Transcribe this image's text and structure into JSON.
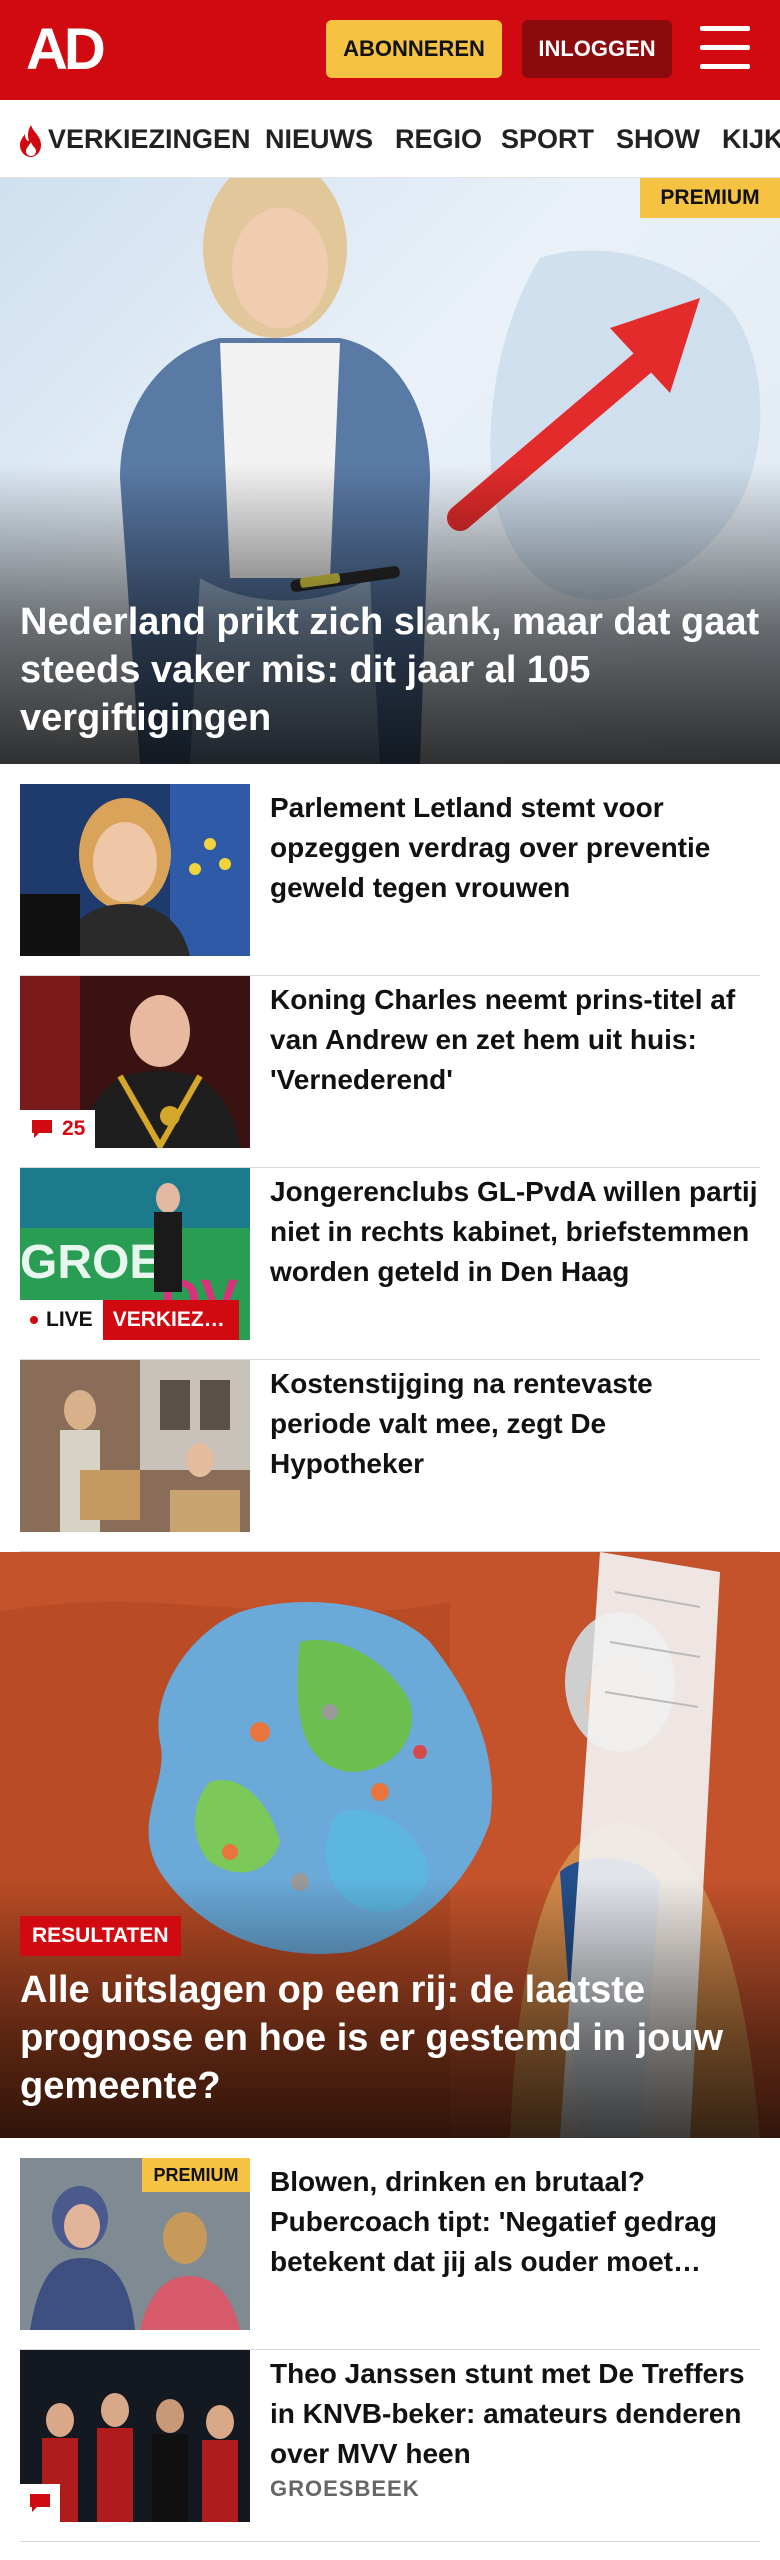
{
  "header": {
    "logo": "AD",
    "subscribe_label": "ABONNEREN",
    "login_label": "INLOGGEN"
  },
  "nav": {
    "items": [
      "VERKIEZINGEN",
      "NIEUWS",
      "REGIO",
      "SPORT",
      "SHOW",
      "KIJK"
    ]
  },
  "hero": {
    "badge": "PREMIUM",
    "title": "Nederland prikt zich slank, maar dat gaat steeds vaker mis: dit jaar al 105 vergiftigingen"
  },
  "articles": [
    {
      "title": "Parlement Letland stemt voor opzeggen verdrag over preventie geweld tegen vrouwen"
    },
    {
      "title": "Koning Charles neemt prins-titel af van Andrew en zet hem uit huis: 'Vernederend'",
      "comments": "25"
    },
    {
      "title": "Jongerenclubs GL-PvdA willen partij niet in rechts kabinet, briefstemmen worden geteld in Den Haag",
      "live": "LIVE",
      "tag": "VERKIEZINGEN"
    },
    {
      "title": "Kostenstijging na rentevaste periode valt mee, zegt De Hypotheker"
    }
  ],
  "feature": {
    "badge": "RESULTATEN",
    "title": "Alle uitslagen op een rij: de laatste prognose en hoe is er gestemd in jouw gemeente?"
  },
  "articles2": [
    {
      "title": "Blowen, drinken en brutaal? Pubercoach tipt: 'Negatief gedrag betekent dat jij als ouder moet ingrijpen'",
      "badge": "PREMIUM"
    },
    {
      "title": "Theo Janssen stunt met De Treffers in KNVB-beker: amateurs denderen over MVV heen",
      "location": "GROESBEEK"
    }
  ],
  "colors": {
    "brand_red": "#d10a11",
    "premium_yellow": "#f5c242",
    "login_dark_red": "#8b0a0e"
  }
}
